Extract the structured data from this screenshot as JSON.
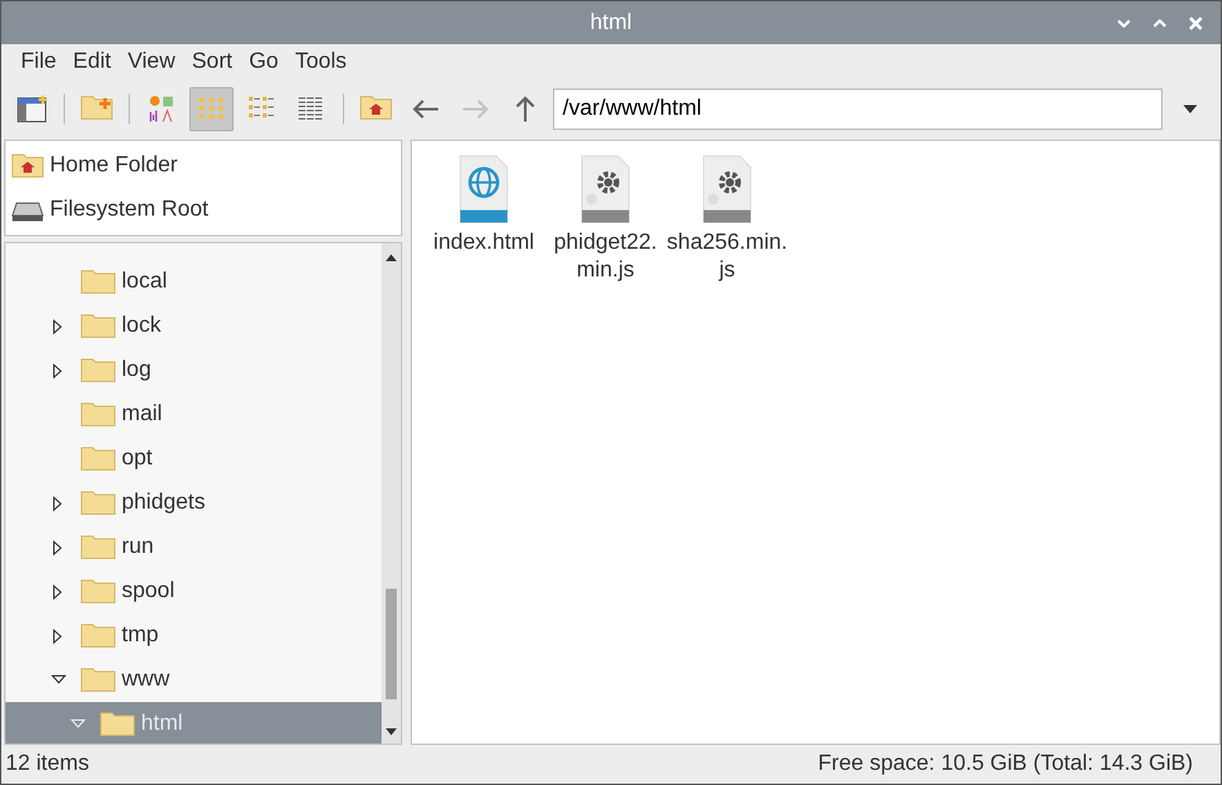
{
  "window": {
    "title": "html"
  },
  "menu": [
    "File",
    "Edit",
    "View",
    "Sort",
    "Go",
    "Tools"
  ],
  "toolbar": [
    {
      "kind": "new-window"
    },
    {
      "kind": "sep"
    },
    {
      "kind": "new-folder"
    },
    {
      "kind": "sep"
    },
    {
      "kind": "view-thumbnails",
      "selected": false
    },
    {
      "kind": "view-icons",
      "selected": true
    },
    {
      "kind": "view-compact",
      "selected": false
    },
    {
      "kind": "view-list",
      "selected": false
    },
    {
      "kind": "sep"
    },
    {
      "kind": "home"
    },
    {
      "kind": "back",
      "disabled": false
    },
    {
      "kind": "forward",
      "disabled": true
    },
    {
      "kind": "up",
      "disabled": false
    }
  ],
  "location": {
    "value": "/var/www/html"
  },
  "places": [
    {
      "kind": "home",
      "label": "Home Folder"
    },
    {
      "kind": "drive",
      "label": "Filesystem Root"
    }
  ],
  "tree": [
    {
      "label": "local",
      "selected": false
    },
    {
      "label": "lock",
      "expanded": false,
      "selected": false
    },
    {
      "label": "log",
      "expanded": false,
      "selected": false
    },
    {
      "label": "mail",
      "selected": false
    },
    {
      "label": "opt",
      "selected": false
    },
    {
      "label": "phidgets",
      "expanded": false,
      "selected": false
    },
    {
      "label": "run",
      "expanded": false,
      "selected": false
    },
    {
      "label": "spool",
      "expanded": false,
      "selected": false
    },
    {
      "label": "tmp",
      "expanded": false,
      "selected": false
    },
    {
      "label": "www",
      "expanded": true,
      "selected": false,
      "children": [
        {
          "label": "html",
          "expanded": true,
          "selected": true
        }
      ]
    }
  ],
  "files": [
    {
      "kind": "html",
      "name": "index.html"
    },
    {
      "kind": "script",
      "name": "phidget22.\nmin.js"
    },
    {
      "kind": "script",
      "name": "sha256.min.\njs"
    }
  ],
  "status_bar": {
    "items": "12 items",
    "free_space": "Free space: 10.5 GiB (Total: 14.3 GiB)"
  }
}
